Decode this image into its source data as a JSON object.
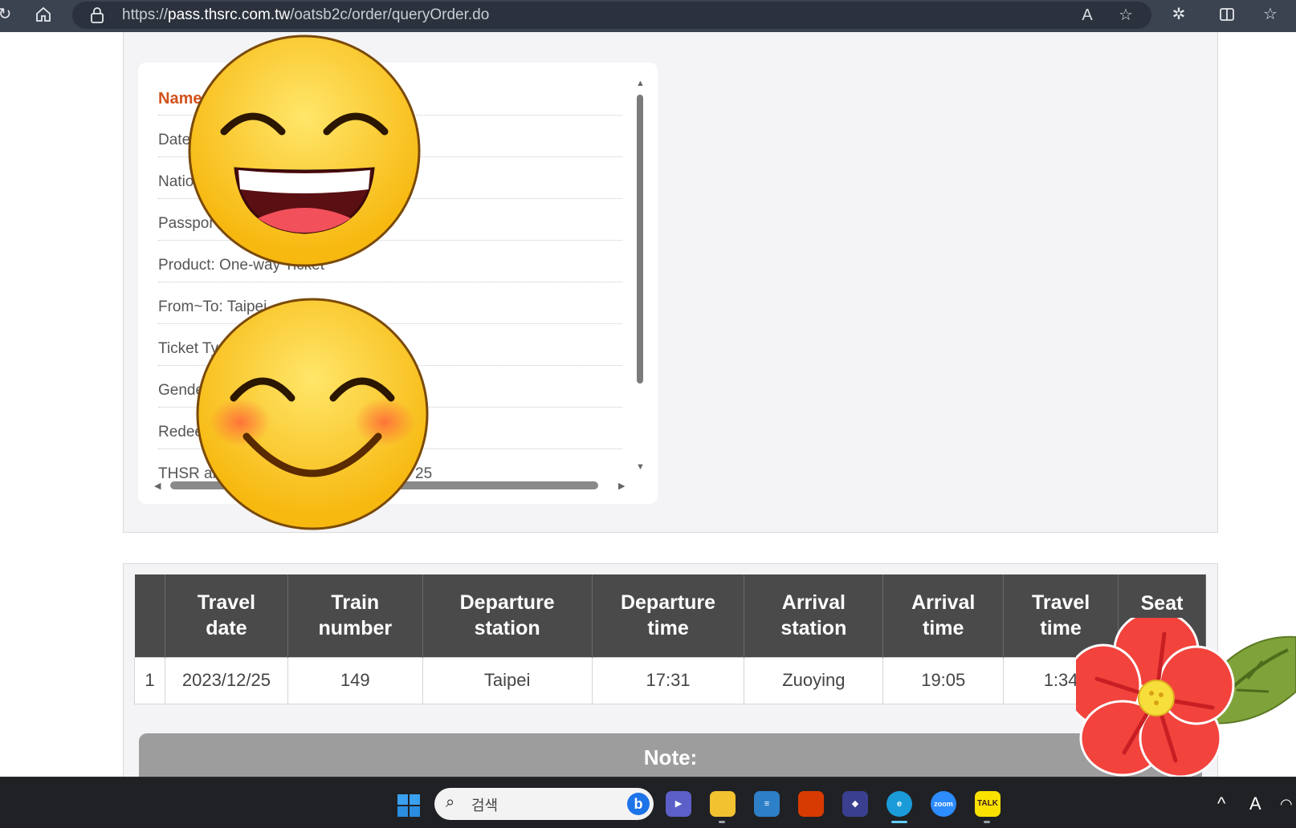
{
  "browser": {
    "url_prefix": "https://",
    "url_host": "pass.thsrc.com.tw",
    "url_path": "/oatsb2c/order/queryOrder.do"
  },
  "passenger_info": {
    "rows": [
      "Name",
      "Date",
      "Natio",
      "Passpor",
      "Product: One-way Ticket",
      "From~To: Taipei",
      "Ticket Ty",
      "Gende",
      "Redee",
      "THSR ab"
    ],
    "row_tail_last": "25"
  },
  "trip_table": {
    "headers": [
      {
        "line1": "",
        "line2": ""
      },
      {
        "line1": "Travel",
        "line2": "date"
      },
      {
        "line1": "Train",
        "line2": "number"
      },
      {
        "line1": "Departure",
        "line2": "station"
      },
      {
        "line1": "Departure",
        "line2": "time"
      },
      {
        "line1": "Arrival",
        "line2": "station"
      },
      {
        "line1": "Arrival",
        "line2": "time"
      },
      {
        "line1": "Travel",
        "line2": "time"
      },
      {
        "line1": "Seat",
        "line2": ""
      }
    ],
    "rows": [
      [
        "1",
        "2023/12/25",
        "149",
        "Taipei",
        "17:31",
        "Zuoying",
        "19:05",
        "1:34",
        ""
      ]
    ]
  },
  "note": {
    "label": "Note:"
  },
  "taskbar": {
    "search_placeholder": "검색",
    "zoom_label": "zoom",
    "talk_label": "TALK",
    "tray_font_label": "A"
  },
  "colors": {
    "accent_orange": "#d2521b",
    "table_header": "#4a4a4a",
    "topbar": "#3b4250",
    "taskbar": "#202124"
  },
  "icons": {
    "overlay_1": "grinning-face-emoji",
    "overlay_2": "smiling-face-emoji",
    "overlay_3": "red-flower-sticker"
  }
}
